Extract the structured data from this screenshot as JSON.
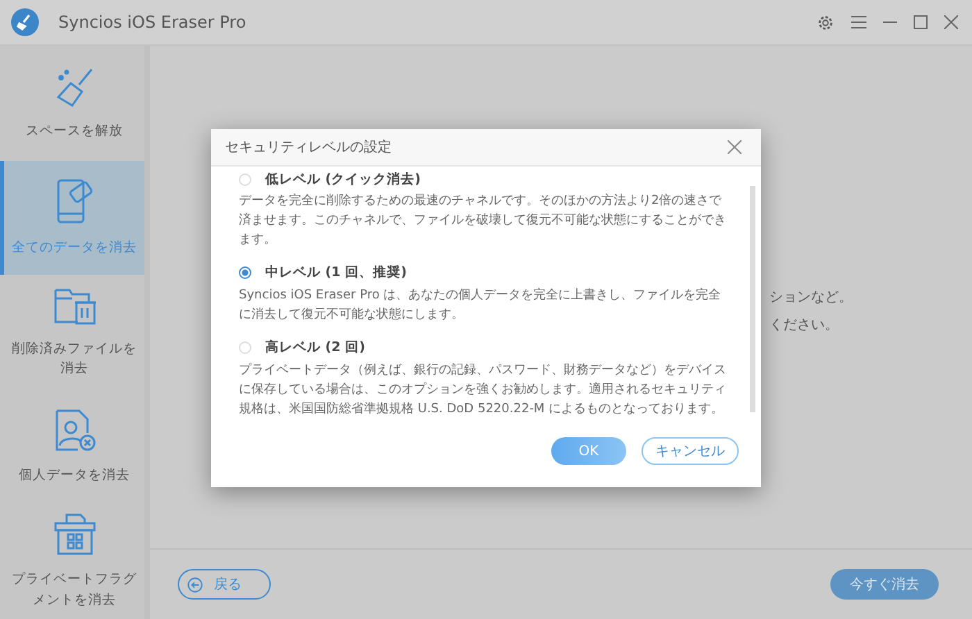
{
  "window": {
    "title": "Syncios iOS Eraser Pro"
  },
  "sidebar": {
    "items": [
      {
        "label": "スペースを解放",
        "kind": "broom",
        "selected": false
      },
      {
        "label": "全てのデータを消去",
        "kind": "phone",
        "selected": true
      },
      {
        "label": "削除済みファイルを消去",
        "kind": "folder",
        "selected": false
      },
      {
        "label": "個人データを消去",
        "kind": "person",
        "selected": false
      },
      {
        "label": "プライベートフラグメントを消去",
        "kind": "box",
        "selected": false
      }
    ]
  },
  "main": {
    "lines": [
      "ションなど。",
      "ください。"
    ],
    "back_button": "戻る",
    "erase_button": "今すぐ消去"
  },
  "dialog": {
    "title": "セキュリティレベルの設定",
    "options": [
      {
        "label": "低レベル (クイック消去)",
        "selected": false,
        "description": "データを完全に削除するための最速のチャネルです。そのほかの方法より2倍の速さで済ませます。このチャネルで、ファイルを破壊して復元不可能な状態にすることができます。"
      },
      {
        "label": "中レベル (1 回、推奨)",
        "selected": true,
        "description": "Syncios iOS Eraser Pro は、あなたの個人データを完全に上書きし、ファイルを完全に消去して復元不可能な状態にします。"
      },
      {
        "label": "高レベル (2 回)",
        "selected": false,
        "description": "プライベートデータ（例えば、銀行の記録、パスワード、財務データなど）をデバイスに保存している場合は、このオプションを強くお勧めします。適用されるセキュリティ規格は、米国国防総省準拠規格 U.S. DoD 5220.22-M によるものとなっております。"
      }
    ],
    "ok": "OK",
    "cancel": "キャンセル"
  }
}
